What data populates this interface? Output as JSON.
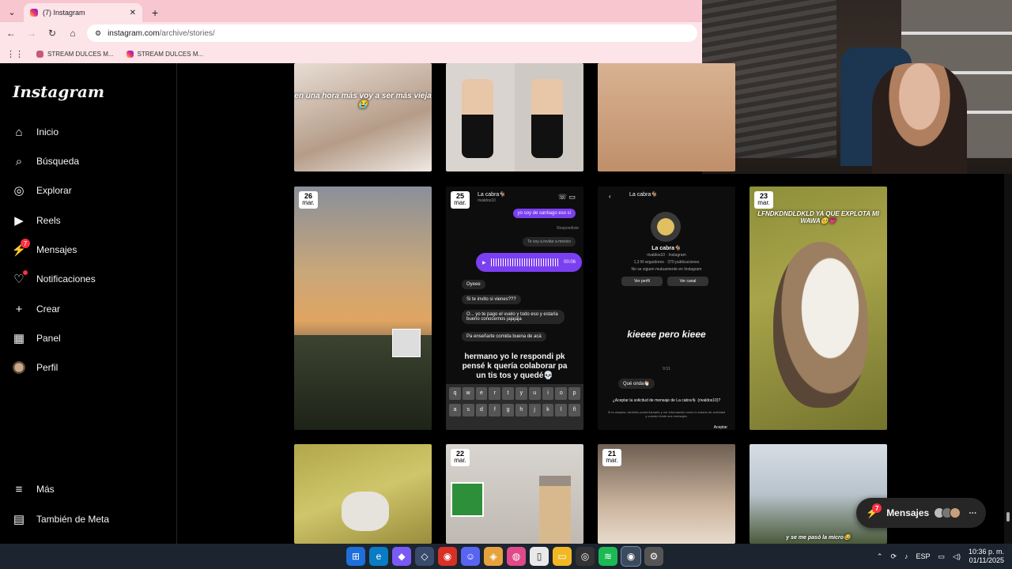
{
  "browser": {
    "tab_title": "(7) Instagram",
    "new_tab": "+",
    "url_host": "instagram.com",
    "url_path": "/archive/stories/",
    "bookmarks": [
      "STREAM DULCES M...",
      "STREAM DULCES M..."
    ]
  },
  "sidebar": {
    "logo": "Instagram",
    "items": [
      {
        "label": "Inicio",
        "icon": "home-icon"
      },
      {
        "label": "Búsqueda",
        "icon": "search-icon"
      },
      {
        "label": "Explorar",
        "icon": "compass-icon"
      },
      {
        "label": "Reels",
        "icon": "reels-icon"
      },
      {
        "label": "Mensajes",
        "icon": "messenger-icon",
        "badge": "7"
      },
      {
        "label": "Notificaciones",
        "icon": "heart-icon"
      },
      {
        "label": "Crear",
        "icon": "plus-icon"
      },
      {
        "label": "Panel",
        "icon": "dashboard-icon"
      },
      {
        "label": "Perfil",
        "icon": "avatar"
      }
    ],
    "bottom": [
      {
        "label": "Más",
        "icon": "menu-icon"
      },
      {
        "label": "También de Meta",
        "icon": "meta-icon"
      }
    ]
  },
  "stories": {
    "row1": [
      {
        "caption": "en una hora más voy a ser más vieja😭"
      },
      {
        "caption": ""
      },
      {
        "caption": ""
      }
    ],
    "row2": [
      {
        "day": "26",
        "month": "mar."
      },
      {
        "day": "25",
        "month": "mar.",
        "dm_name": "La cabra🐐",
        "dm_handle": "rivaldos10",
        "sent1": "yo soy de santiago eso si",
        "replied": "Respondiste",
        "invite": "Te voy a invitar a mexico",
        "audio_time": "00:06",
        "r1": "Oyeee",
        "r2": "Si te invito si vienes???",
        "r3": "O... yo te pago el vuelo y todo eso y estaría bueno conocernos jajajaja",
        "r4": "Pa enseñarte comida buena de acá",
        "caption": "hermano yo le respondi pk pensé k quería colaborar pa un tis tos y quedé💀",
        "keys1": [
          "q",
          "w",
          "e",
          "r",
          "t",
          "y",
          "u",
          "i",
          "o",
          "p"
        ],
        "keys2": [
          "a",
          "s",
          "d",
          "f",
          "g",
          "h",
          "j",
          "k",
          "l",
          "ñ"
        ]
      },
      {
        "profile_name": "La cabra🐐",
        "profile_sub": "rivaldos10 · Instagram",
        "profile_stats": "1,3 M seguidores · 370 publicaciones",
        "profile_note": "No se siguen mutuamente en Instagram",
        "btn_profile": "Ver perfil",
        "btn_channel": "Ver canal",
        "caption": "kieeee pero kieee",
        "time": "9:31",
        "msg": "Qué onda👋🏻",
        "request": "¿Aceptar la solicitud de mensaje de La cabra🐐 (rivaldos10)?",
        "request_note": "Si la aceptas, también podrá llamarte y ver información como tu estado de actividad y cuándo leíste sus mensajes.",
        "accept": "Aceptar"
      },
      {
        "day": "23",
        "month": "mar.",
        "caption": "LFNDKDNDLDKLD YA QUE EXPLOTA MI WAWA🥺💗"
      }
    ],
    "row3": [
      {
        "caption": ""
      },
      {
        "day": "22",
        "month": "mar."
      },
      {
        "day": "21",
        "month": "mar."
      },
      {
        "caption": "y se me pasó la micro😂"
      }
    ]
  },
  "messages_pill": {
    "label": "Mensajes",
    "badge": "7"
  },
  "taskbar": {
    "lang": "ESP",
    "time": "10:36 p. m.",
    "date": "01/11/2025"
  }
}
